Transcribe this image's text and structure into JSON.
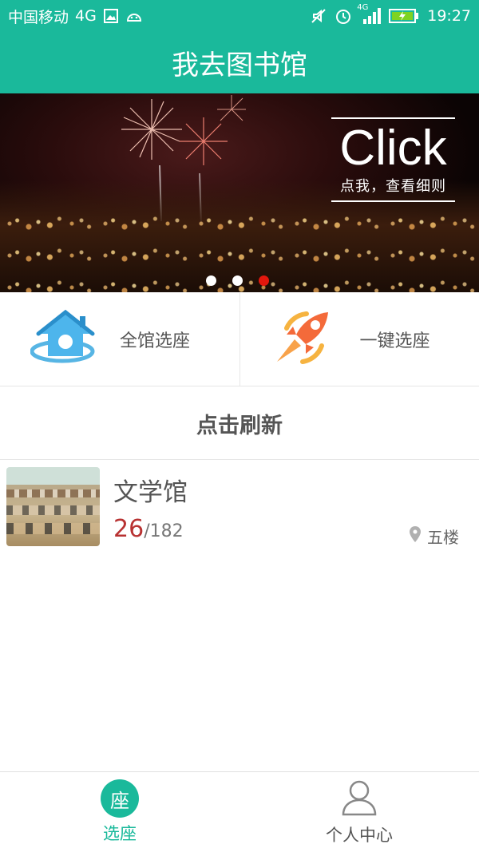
{
  "status_bar": {
    "carrier": "中国移动",
    "network": "4G",
    "signal_label": "4G",
    "time": "19:27",
    "icons": [
      "image-icon",
      "android-icon",
      "mute-icon",
      "alarm-icon",
      "signal-icon",
      "battery-charging-icon"
    ]
  },
  "header": {
    "title": "我去图书馆"
  },
  "banner": {
    "click_text": "Click",
    "click_sub": "点我，查看细则",
    "dots": 3,
    "active_dot_index": 2
  },
  "quick_actions": [
    {
      "label": "全馆选座",
      "icon": "house-icon"
    },
    {
      "label": "一键选座",
      "icon": "rocket-icon"
    }
  ],
  "refresh_label": "点击刷新",
  "library": {
    "name": "文学馆",
    "available": "26",
    "total": "/182",
    "location": "五楼"
  },
  "tabbar": {
    "tabs": [
      {
        "label": "选座",
        "icon_text": "座",
        "active": true
      },
      {
        "label": "个人中心",
        "icon": "person-icon",
        "active": false
      }
    ]
  },
  "colors": {
    "primary": "#1ab99b",
    "accent_red": "#b83232"
  }
}
